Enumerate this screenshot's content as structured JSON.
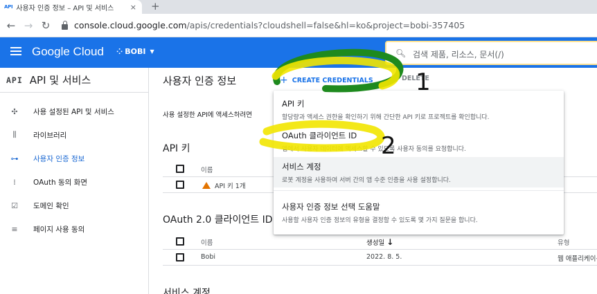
{
  "browser": {
    "tab": {
      "favicon": "API",
      "title": "사용자 인증 정보 – API 및 서비스",
      "close": "×"
    },
    "new_tab": "+",
    "url_host": "console.cloud.google.com",
    "url_path": "/apis/credentials?cloudshell=false&hl=ko&project=bobi-357405",
    "icons": {
      "back": "arrow-left-icon",
      "forward": "arrow-right-icon",
      "reload": "reload-icon",
      "lock": "lock-icon"
    }
  },
  "header": {
    "brand": "Google Cloud",
    "project": "BOBI",
    "search_placeholder": "검색  제품, 리소스, 문서(/)",
    "bg_color": "#1a73e8"
  },
  "sidebar": {
    "logo": "API",
    "title": "API 및 서비스",
    "items": [
      {
        "label": "사용 설정된 API 및 서비스",
        "icon": "diamond-grid-icon",
        "glyph": "✣"
      },
      {
        "label": "라이브러리",
        "icon": "library-icon",
        "glyph": "⫼"
      },
      {
        "label": "사용자 인증 정보",
        "icon": "key-icon",
        "glyph": "⊶"
      },
      {
        "label": "OAuth 동의 화면",
        "icon": "consent-icon",
        "glyph": "⁞"
      },
      {
        "label": "도메인 확인",
        "icon": "domain-check-icon",
        "glyph": "☑"
      },
      {
        "label": "페이지 사용 동의",
        "icon": "settings-list-icon",
        "glyph": "≡"
      }
    ],
    "active_index": 2,
    "active_color": "#1967d2"
  },
  "main": {
    "title": "사용자 인증 정보",
    "create_label": "CREATE CREDENTIALS",
    "delete_label": "DELETE",
    "description": "사용 설정한 API에 액세스하려면",
    "api_keys": {
      "section": "API 키",
      "col_name": "이름",
      "rows": [
        {
          "name": "API 키 1개"
        }
      ]
    },
    "oauth": {
      "section": "OAuth 2.0 클라이언트 ID",
      "col_name": "이름",
      "col_created": "생성일",
      "col_type": "유형",
      "rows": [
        {
          "name": "Bobi",
          "created": "2022. 8. 5.",
          "type": "웹 애플리케이션"
        }
      ]
    },
    "service_accounts": {
      "section": "서비스 계정"
    }
  },
  "dropdown": {
    "items": [
      {
        "title": "API 키",
        "desc": "할당량과 액세스 권한을 확인하기 위해 간단한 API 키로 프로젝트를 확인합니다."
      },
      {
        "title": "OAuth 클라이언트 ID",
        "desc": "앱에서 사용자 데이터에 액세스할 수 있도록 사용자 동의를 요청합니다."
      },
      {
        "title": "서비스 계정",
        "desc": "로봇 계정을 사용하여 서버 간의 앱 수준 인증을 사용 설정합니다."
      },
      {
        "title": "사용자 인증 정보 선택 도움말",
        "desc": "사용할 사용자 인증 정보의 유형을 결정할 수 있도록 몇 가지 질문을 합니다."
      }
    ],
    "highlight_index": 2
  },
  "annotations": {
    "mark_1": "1",
    "mark_2": "2",
    "highlight_color": "#f2e600",
    "circle_color": "#1e8a1e"
  }
}
